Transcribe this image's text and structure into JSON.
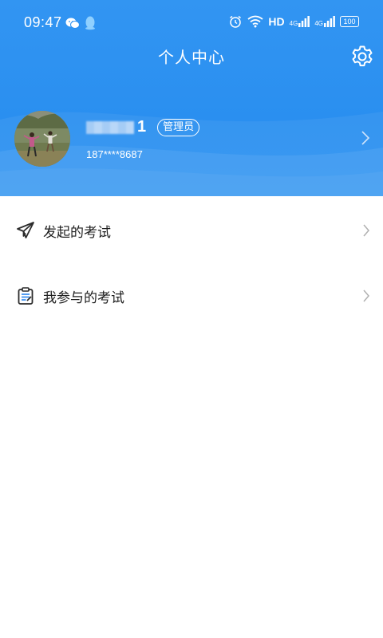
{
  "status_bar": {
    "time": "09:47",
    "hd": "HD",
    "net_4g": "4G",
    "battery": "100"
  },
  "header": {
    "title": "个人中心"
  },
  "profile": {
    "name_visible": "1",
    "role": "管理员",
    "phone": "187****8687"
  },
  "menu": [
    {
      "label": "发起的考试",
      "icon": "paper-plane-icon"
    },
    {
      "label": "我参与的考试",
      "icon": "clipboard-icon"
    }
  ],
  "colors": {
    "header_blue": "#2a8ff0",
    "text_dark": "#1e1e1e",
    "chevron_gray": "#b0b0b0"
  }
}
